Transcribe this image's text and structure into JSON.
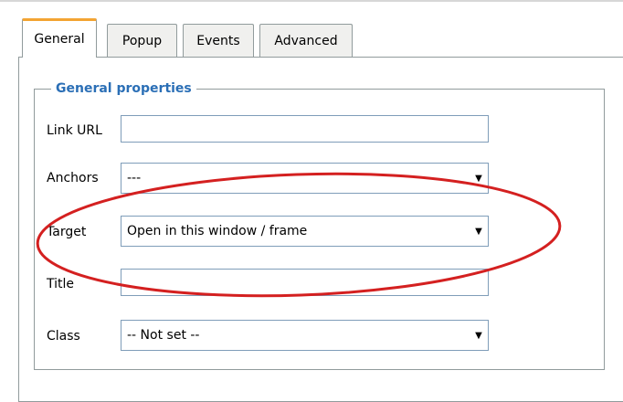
{
  "tabs": [
    {
      "label": "General",
      "active": true
    },
    {
      "label": "Popup",
      "active": false
    },
    {
      "label": "Events",
      "active": false
    },
    {
      "label": "Advanced",
      "active": false
    }
  ],
  "group": {
    "legend": "General properties"
  },
  "fields": {
    "link_url": {
      "label": "Link URL",
      "value": ""
    },
    "anchors": {
      "label": "Anchors",
      "value": "---"
    },
    "target": {
      "label": "Target",
      "value": "Open in this window / frame"
    },
    "title": {
      "label": "Title",
      "value": ""
    },
    "class": {
      "label": "Class",
      "value": "-- Not set --"
    }
  },
  "icons": {
    "dropdown": "chevron-down-icon"
  },
  "colors": {
    "tab_accent": "#f3a432",
    "legend_text": "#2b6fb6",
    "annotation": "#d42020"
  }
}
